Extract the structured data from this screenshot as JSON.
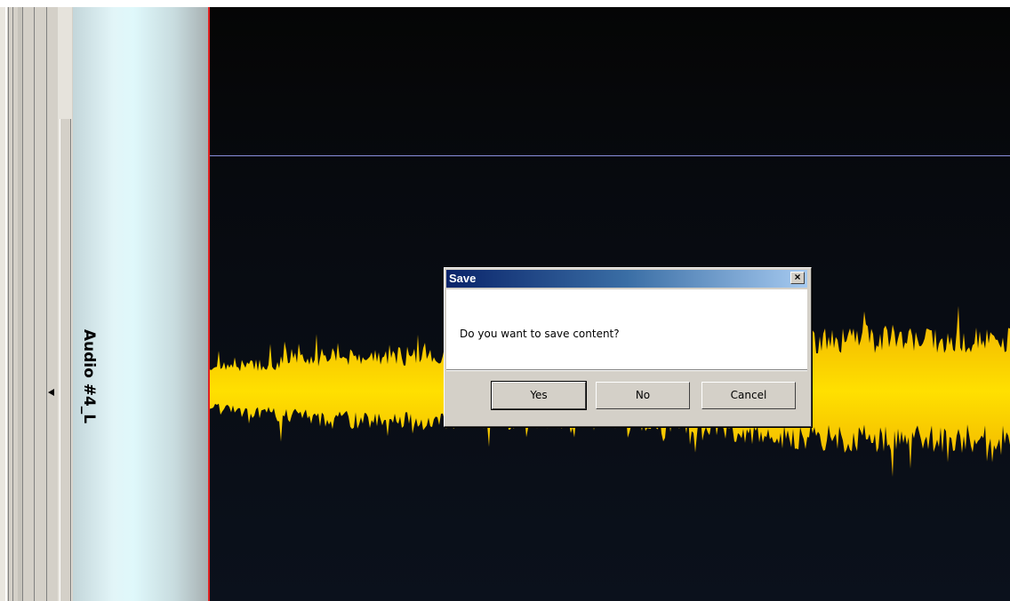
{
  "track": {
    "name": "Audio #4_L"
  },
  "colors": {
    "waveform": "#ffd700",
    "playhead": "#e02020",
    "divider": "#8a8fdc",
    "dialog_title_start": "#0a246a",
    "dialog_title_end": "#a6caf0"
  },
  "dialog": {
    "title": "Save",
    "close_label": "×",
    "message": "Do you want to save content?",
    "buttons": {
      "yes": "Yes",
      "no": "No",
      "cancel": "Cancel"
    }
  }
}
